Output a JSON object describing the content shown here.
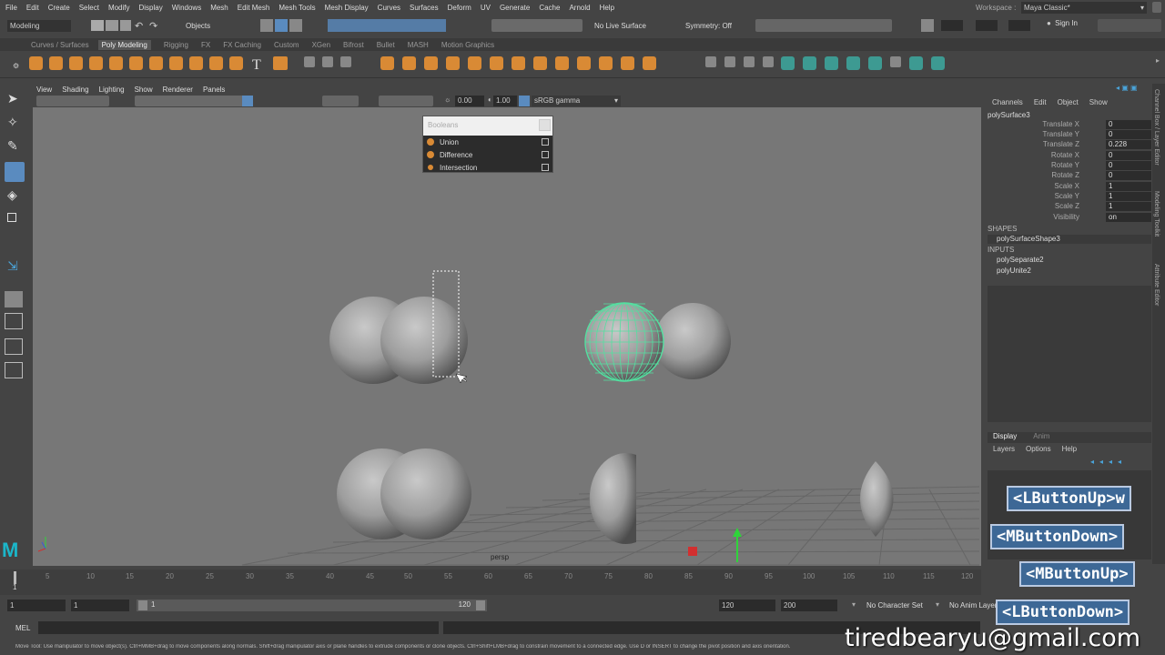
{
  "menu": [
    "File",
    "Edit",
    "Create",
    "Select",
    "Modify",
    "Display",
    "Windows",
    "Mesh",
    "Edit Mesh",
    "Mesh Tools",
    "Mesh Display",
    "Curves",
    "Surfaces",
    "Deform",
    "UV",
    "Generate",
    "Cache",
    "Arnold",
    "Help"
  ],
  "workspace": {
    "label": "Workspace :",
    "value": "Maya Classic*"
  },
  "status": {
    "mode": "Modeling",
    "objects": "Objects",
    "live": "No Live Surface",
    "symmetry": "Symmetry: Off",
    "signin": "Sign In"
  },
  "shelf_tabs": [
    "Curves / Surfaces",
    "Poly Modeling",
    "Rigging",
    "FX",
    "FX Caching",
    "Custom",
    "XGen",
    "Bifrost",
    "Bullet",
    "MASH",
    "Motion Graphics"
  ],
  "panel_menu": [
    "View",
    "Shading",
    "Lighting",
    "Show",
    "Renderer",
    "Panels"
  ],
  "panel_toolbar": {
    "val1": "0.00",
    "val2": "1.00",
    "colorspace": "sRGB gamma"
  },
  "booleans": {
    "title": "Booleans",
    "items": [
      "Union",
      "Difference",
      "Intersection"
    ]
  },
  "viewport": {
    "camera": "persp"
  },
  "channel_box": {
    "menu": [
      "Channels",
      "Edit",
      "Object",
      "Show"
    ],
    "object": "polySurface3",
    "attrs": [
      {
        "label": "Translate X",
        "value": "0"
      },
      {
        "label": "Translate Y",
        "value": "0"
      },
      {
        "label": "Translate Z",
        "value": "0.228"
      },
      {
        "label": "Rotate X",
        "value": "0"
      },
      {
        "label": "Rotate Y",
        "value": "0"
      },
      {
        "label": "Rotate Z",
        "value": "0"
      },
      {
        "label": "Scale X",
        "value": "1"
      },
      {
        "label": "Scale Y",
        "value": "1"
      },
      {
        "label": "Scale Z",
        "value": "1"
      },
      {
        "label": "Visibility",
        "value": "on"
      }
    ],
    "shapes_header": "SHAPES",
    "shape": "polySurfaceShape3",
    "inputs_header": "INPUTS",
    "inputs": [
      "polySeparate2",
      "polyUnite2"
    ]
  },
  "layer_editor": {
    "tabs": [
      "Display",
      "Anim"
    ],
    "menu": [
      "Layers",
      "Options",
      "Help"
    ]
  },
  "side_tabs": [
    "Channel Box / Layer Editor",
    "Modeling Toolkit",
    "Attribute Editor"
  ],
  "timeline": {
    "ticks": [
      "5",
      "10",
      "15",
      "20",
      "25",
      "30",
      "35",
      "40",
      "45",
      "50",
      "55",
      "60",
      "65",
      "70",
      "75",
      "80",
      "85",
      "90",
      "95",
      "100",
      "105",
      "110",
      "115",
      "120"
    ],
    "frame": "1"
  },
  "range": {
    "start": "1",
    "inner_start": "1",
    "slider_start": "1",
    "slider_end": "120",
    "end": "120",
    "max": "200",
    "character_set": "No Character Set",
    "anim_layer": "No Anim Layer"
  },
  "cmd": {
    "label": "MEL"
  },
  "help_text": "Move Tool: Use manipulator to move object(s). Ctrl+MMB+drag to move components along normals. Shift+drag manipulator axis or plane handles to extrude components or clone objects. Ctrl+Shift+LMB+drag to constrain movement to a connected edge. Use D or INSERT to change the pivot position and axis orientation.",
  "overlay": {
    "badges": [
      "<LButtonUp>w",
      "<MButtonDown>",
      "<MButtonUp>",
      "<LButtonDown>"
    ],
    "watermark": "tiredbearyu@gmail.com"
  },
  "colors": {
    "accent_orange": "#d98a35",
    "selection_green": "#53e0a0",
    "badge_blue": "#3d6896",
    "maya_logo": "#1bb6c9"
  }
}
